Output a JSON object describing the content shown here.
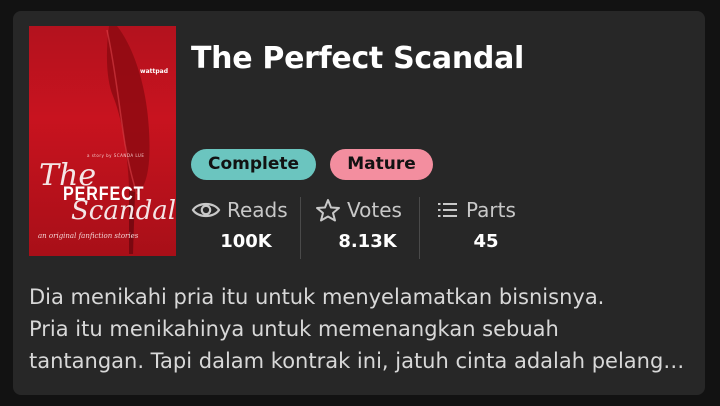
{
  "story": {
    "title": "The Perfect Scandal",
    "cover": {
      "publisher_badge": "wattpad",
      "author_line": "a story by SCANDA LUE",
      "title_line1": "The",
      "title_line2": "PERFECT",
      "title_line3": "Scandal",
      "tagline": "an original fanfiction stories"
    },
    "tags": [
      "Complete",
      "Mature"
    ],
    "stats": {
      "reads_label": "Reads",
      "reads_value": "100K",
      "votes_label": "Votes",
      "votes_value": "8.13K",
      "parts_label": "Parts",
      "parts_value": "45"
    },
    "description": [
      "Dia menikahi pria itu untuk menyelamatkan bisnisnya.",
      "Pria itu menikahinya untuk memenangkan sebuah",
      "tantangan. Tapi dalam kontrak ini, jatuh cinta adalah pelanggaran."
    ]
  },
  "colors": {
    "background": "#121212",
    "card": "#272727",
    "complete_tag": "#6bc5bf",
    "mature_tag": "#f38e9f",
    "cover_red": "#c8131f"
  },
  "icons": {
    "reads": "eye-icon",
    "votes": "star-icon",
    "parts": "list-icon"
  }
}
